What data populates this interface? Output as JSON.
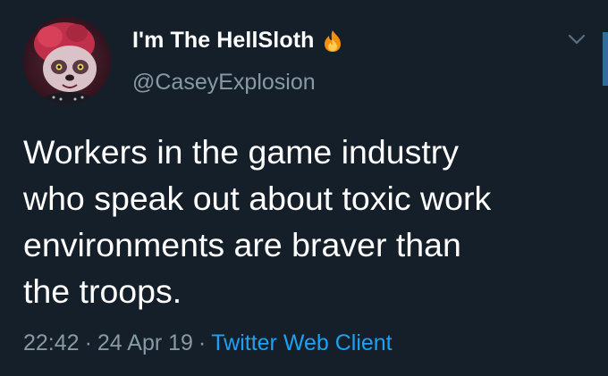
{
  "user": {
    "display_name": "I'm The HellSloth",
    "display_name_emoji": "fire-emoji",
    "handle": "@CaseyExplosion"
  },
  "tweet": {
    "text": "Workers in the game industry\nwho speak out about toxic work\nenvironments are braver than\nthe troops."
  },
  "meta": {
    "time": "22:42",
    "separator": "·",
    "date": "24 Apr 19",
    "client": "Twitter Web Client"
  },
  "colors": {
    "background": "#151f2a",
    "text_primary": "#ffffff",
    "text_secondary": "#8899a6",
    "link": "#1da1f2"
  },
  "icons": {
    "menu": "chevron-down-icon",
    "flame": "fire-icon"
  }
}
